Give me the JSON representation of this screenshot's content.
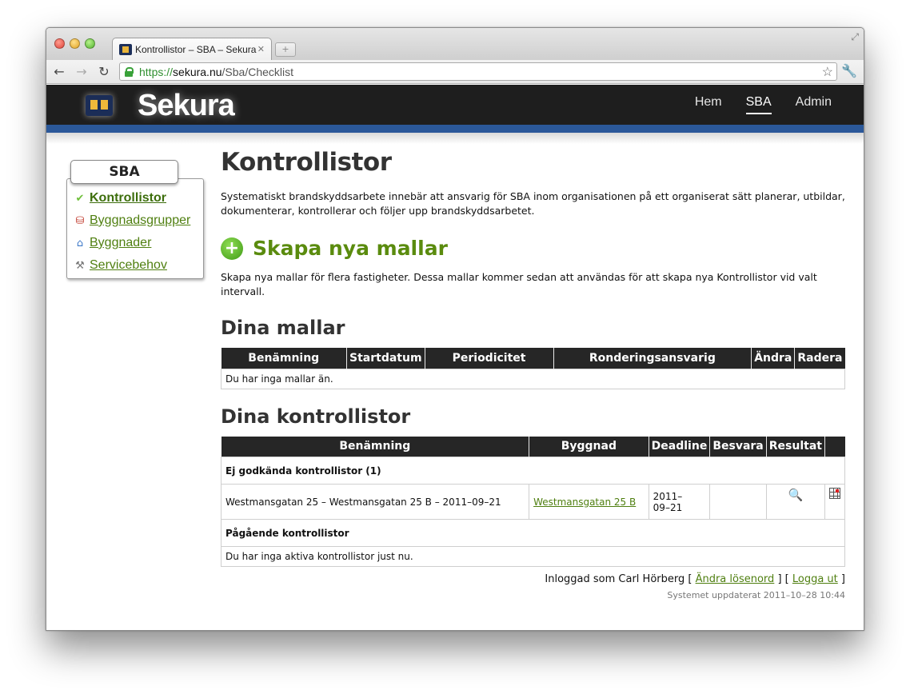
{
  "browser": {
    "tab_title": "Kontrollistor – SBA – Sekura",
    "url_scheme": "https://",
    "url_host": "sekura.nu",
    "url_path": "/Sba/Checklist"
  },
  "site": {
    "brand": "Sekura",
    "nav": [
      {
        "label": "Hem"
      },
      {
        "label": "SBA",
        "active": true
      },
      {
        "label": "Admin"
      }
    ],
    "header_color": "#1e1e1e",
    "stripe_color": "#2b5899",
    "link_color": "#4f7f10"
  },
  "sidebar": {
    "title": "SBA",
    "items": [
      {
        "label": "Kontrollistor",
        "icon": "check-icon",
        "active": true
      },
      {
        "label": "Byggnadsgrupper",
        "icon": "building-group-icon"
      },
      {
        "label": "Byggnader",
        "icon": "building-icon"
      },
      {
        "label": "Servicebehov",
        "icon": "tool-icon"
      }
    ]
  },
  "main": {
    "title": "Kontrollistor",
    "intro": "Systematiskt brandskyddsarbete innebär att ansvarig för SBA inom organisationen på ett organiserat sätt planerar, utbildar, dokumenterar, kontrollerar och följer upp brandskyddsarbetet.",
    "create": {
      "icon": "plus-circle-icon",
      "heading": "Skapa nya mallar",
      "text": "Skapa nya mallar för flera fastigheter. Dessa mallar kommer sedan att användas för att skapa nya Kontrollistor vid valt intervall."
    },
    "templates": {
      "heading": "Dina mallar",
      "columns": [
        "Benämning",
        "Startdatum",
        "Periodicitet",
        "Ronderingsansvarig",
        "Ändra",
        "Radera"
      ],
      "empty_text": "Du har inga mallar än."
    },
    "checklists": {
      "heading": "Dina kontrollistor",
      "columns": [
        "Benämning",
        "Byggnad",
        "Deadline",
        "Besvara",
        "Resultat",
        ""
      ],
      "section_not_approved": "Ej godkända kontrollistor (1)",
      "rows": [
        {
          "name": "Westmansgatan 25 – Westmansgatan 25 B – 2011–09–21",
          "building": "Westmansgatan 25 B",
          "deadline": "2011–\n09–21",
          "answer_icon": "search-icon",
          "result_icon": "result-grid-icon"
        }
      ],
      "section_ongoing": "Pågående kontrollistor",
      "ongoing_empty": "Du har inga aktiva kontrollistor just nu."
    },
    "footer": {
      "logged_in_prefix": "Inloggad som Carl Hörberg [ ",
      "change_password": "Ändra lösenord",
      "separator": " ] [ ",
      "logout": "Logga ut",
      "suffix": " ]",
      "updated": "Systemet uppdaterat 2011–10–28 10:44"
    }
  }
}
